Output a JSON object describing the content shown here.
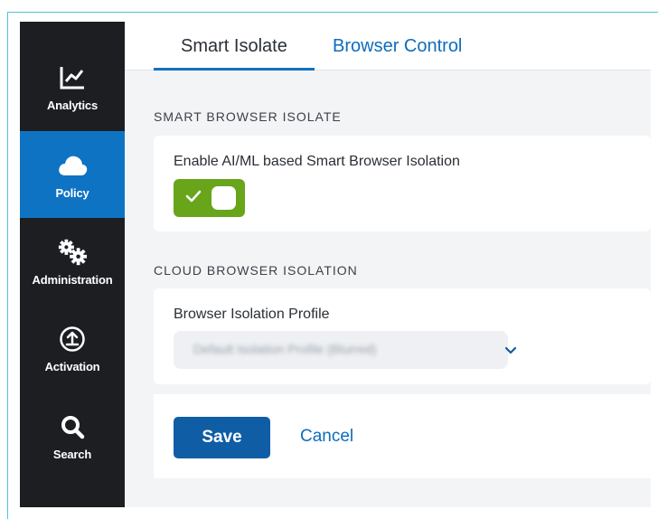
{
  "sidebar": {
    "items": [
      {
        "label": "Analytics",
        "icon": "analytics-chart-icon",
        "active": false
      },
      {
        "label": "Policy",
        "icon": "cloud-icon",
        "active": true
      },
      {
        "label": "Administration",
        "icon": "gears-icon",
        "active": false
      },
      {
        "label": "Activation",
        "icon": "upload-circle-icon",
        "active": false
      },
      {
        "label": "Search",
        "icon": "search-icon",
        "active": false
      }
    ]
  },
  "tabs": {
    "smart_isolate": "Smart Isolate",
    "browser_control": "Browser Control"
  },
  "smart_browser_isolate": {
    "section_title": "SMART BROWSER ISOLATE",
    "toggle_label": "Enable AI/ML based Smart Browser Isolation",
    "toggle_on": true
  },
  "cloud_browser_isolation": {
    "section_title": "CLOUD BROWSER ISOLATION",
    "profile_label": "Browser Isolation Profile",
    "profile_value": "Default Isolation Profile (Blurred)"
  },
  "actions": {
    "save": "Save",
    "cancel": "Cancel"
  },
  "colors": {
    "sidebar_bg": "#1c1e22",
    "sidebar_active": "#0f73c4",
    "toggle_on": "#68a51b",
    "primary_button": "#0f5da5",
    "link": "#0f6cbd"
  }
}
